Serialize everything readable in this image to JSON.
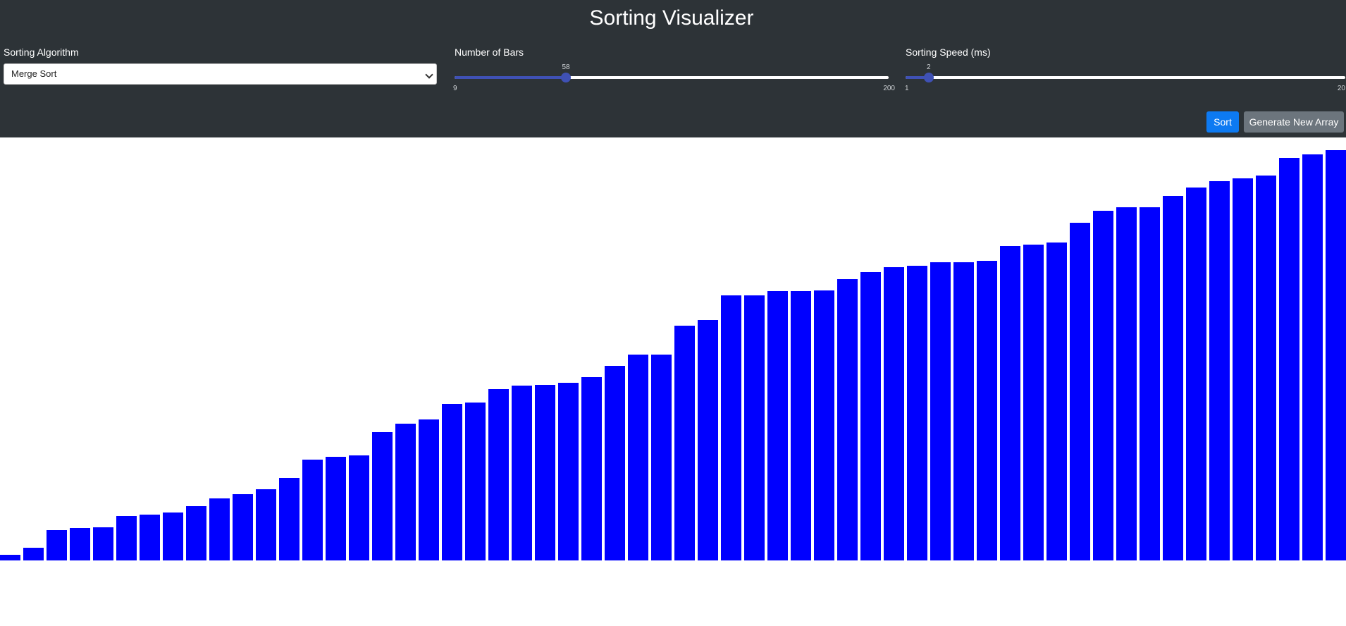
{
  "app": {
    "title": "Sorting Visualizer"
  },
  "controls": {
    "algorithm": {
      "label": "Sorting Algorithm",
      "selected": "Merge Sort"
    },
    "bars": {
      "label": "Number of Bars",
      "value": 58,
      "value_label": "58",
      "min": 9,
      "min_label": "9",
      "max": 200,
      "max_label": "200"
    },
    "speed": {
      "label": "Sorting Speed (ms)",
      "value": 2,
      "value_label": "2",
      "min": 1,
      "min_label": "1",
      "max": 20,
      "max_label": "20"
    }
  },
  "buttons": {
    "sort_label": "Sort",
    "generate_label": "Generate New Array"
  },
  "colors": {
    "header_bg": "#2d3337",
    "bar": "#0000ff",
    "slider_accent": "#3f51b5",
    "sort_button": "#0d7af2",
    "generate_button": "#6c757d"
  },
  "array": {
    "max_value": 600,
    "values": [
      8,
      18,
      43,
      46,
      47,
      63,
      65,
      68,
      77,
      88,
      94,
      101,
      117,
      143,
      147,
      149,
      182,
      194,
      200,
      222,
      224,
      243,
      248,
      249,
      252,
      260,
      276,
      292,
      292,
      333,
      341,
      376,
      376,
      382,
      382,
      383,
      399,
      409,
      416,
      418,
      423,
      423,
      425,
      446,
      448,
      451,
      479,
      496,
      501,
      501,
      517,
      529,
      538,
      542,
      546,
      571,
      576,
      582
    ]
  }
}
